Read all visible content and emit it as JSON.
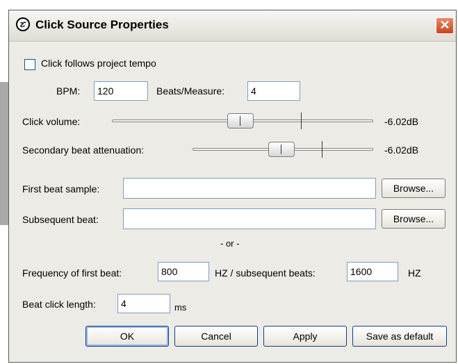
{
  "window": {
    "title": "Click Source Properties",
    "close_glyph": "✕"
  },
  "click_follows": {
    "label": "Click follows project tempo",
    "checked": false
  },
  "bpm": {
    "label": "BPM:",
    "value": "120"
  },
  "beats_measure": {
    "label": "Beats/Measure:",
    "value": "4"
  },
  "click_volume": {
    "label": "Click volume:",
    "value": "-6.02dB"
  },
  "secondary_attenuation": {
    "label": "Secondary beat attenuation:",
    "value": "-6.02dB"
  },
  "first_beat_sample": {
    "label": "First beat sample:",
    "value": "",
    "browse": "Browse..."
  },
  "subsequent_beat": {
    "label": "Subsequent beat:",
    "value": "",
    "browse": "Browse..."
  },
  "or_text": "- or -",
  "frequency": {
    "label": "Frequency of first beat:",
    "first_value": "800",
    "middle_label": "HZ / subsequent beats:",
    "subsequent_value": "1600",
    "unit": "HZ"
  },
  "beat_click_length": {
    "label": "Beat click length:",
    "value": "4",
    "unit": "ms"
  },
  "buttons": {
    "ok": "OK",
    "cancel": "Cancel",
    "apply": "Apply",
    "save_default": "Save as default"
  },
  "icons": {
    "title_icon": "metronome-icon",
    "close_icon": "close-icon"
  },
  "colors": {
    "close": "#c8451f",
    "dialog_bg": "#ecebe6",
    "button_border": "#0f3f86"
  }
}
